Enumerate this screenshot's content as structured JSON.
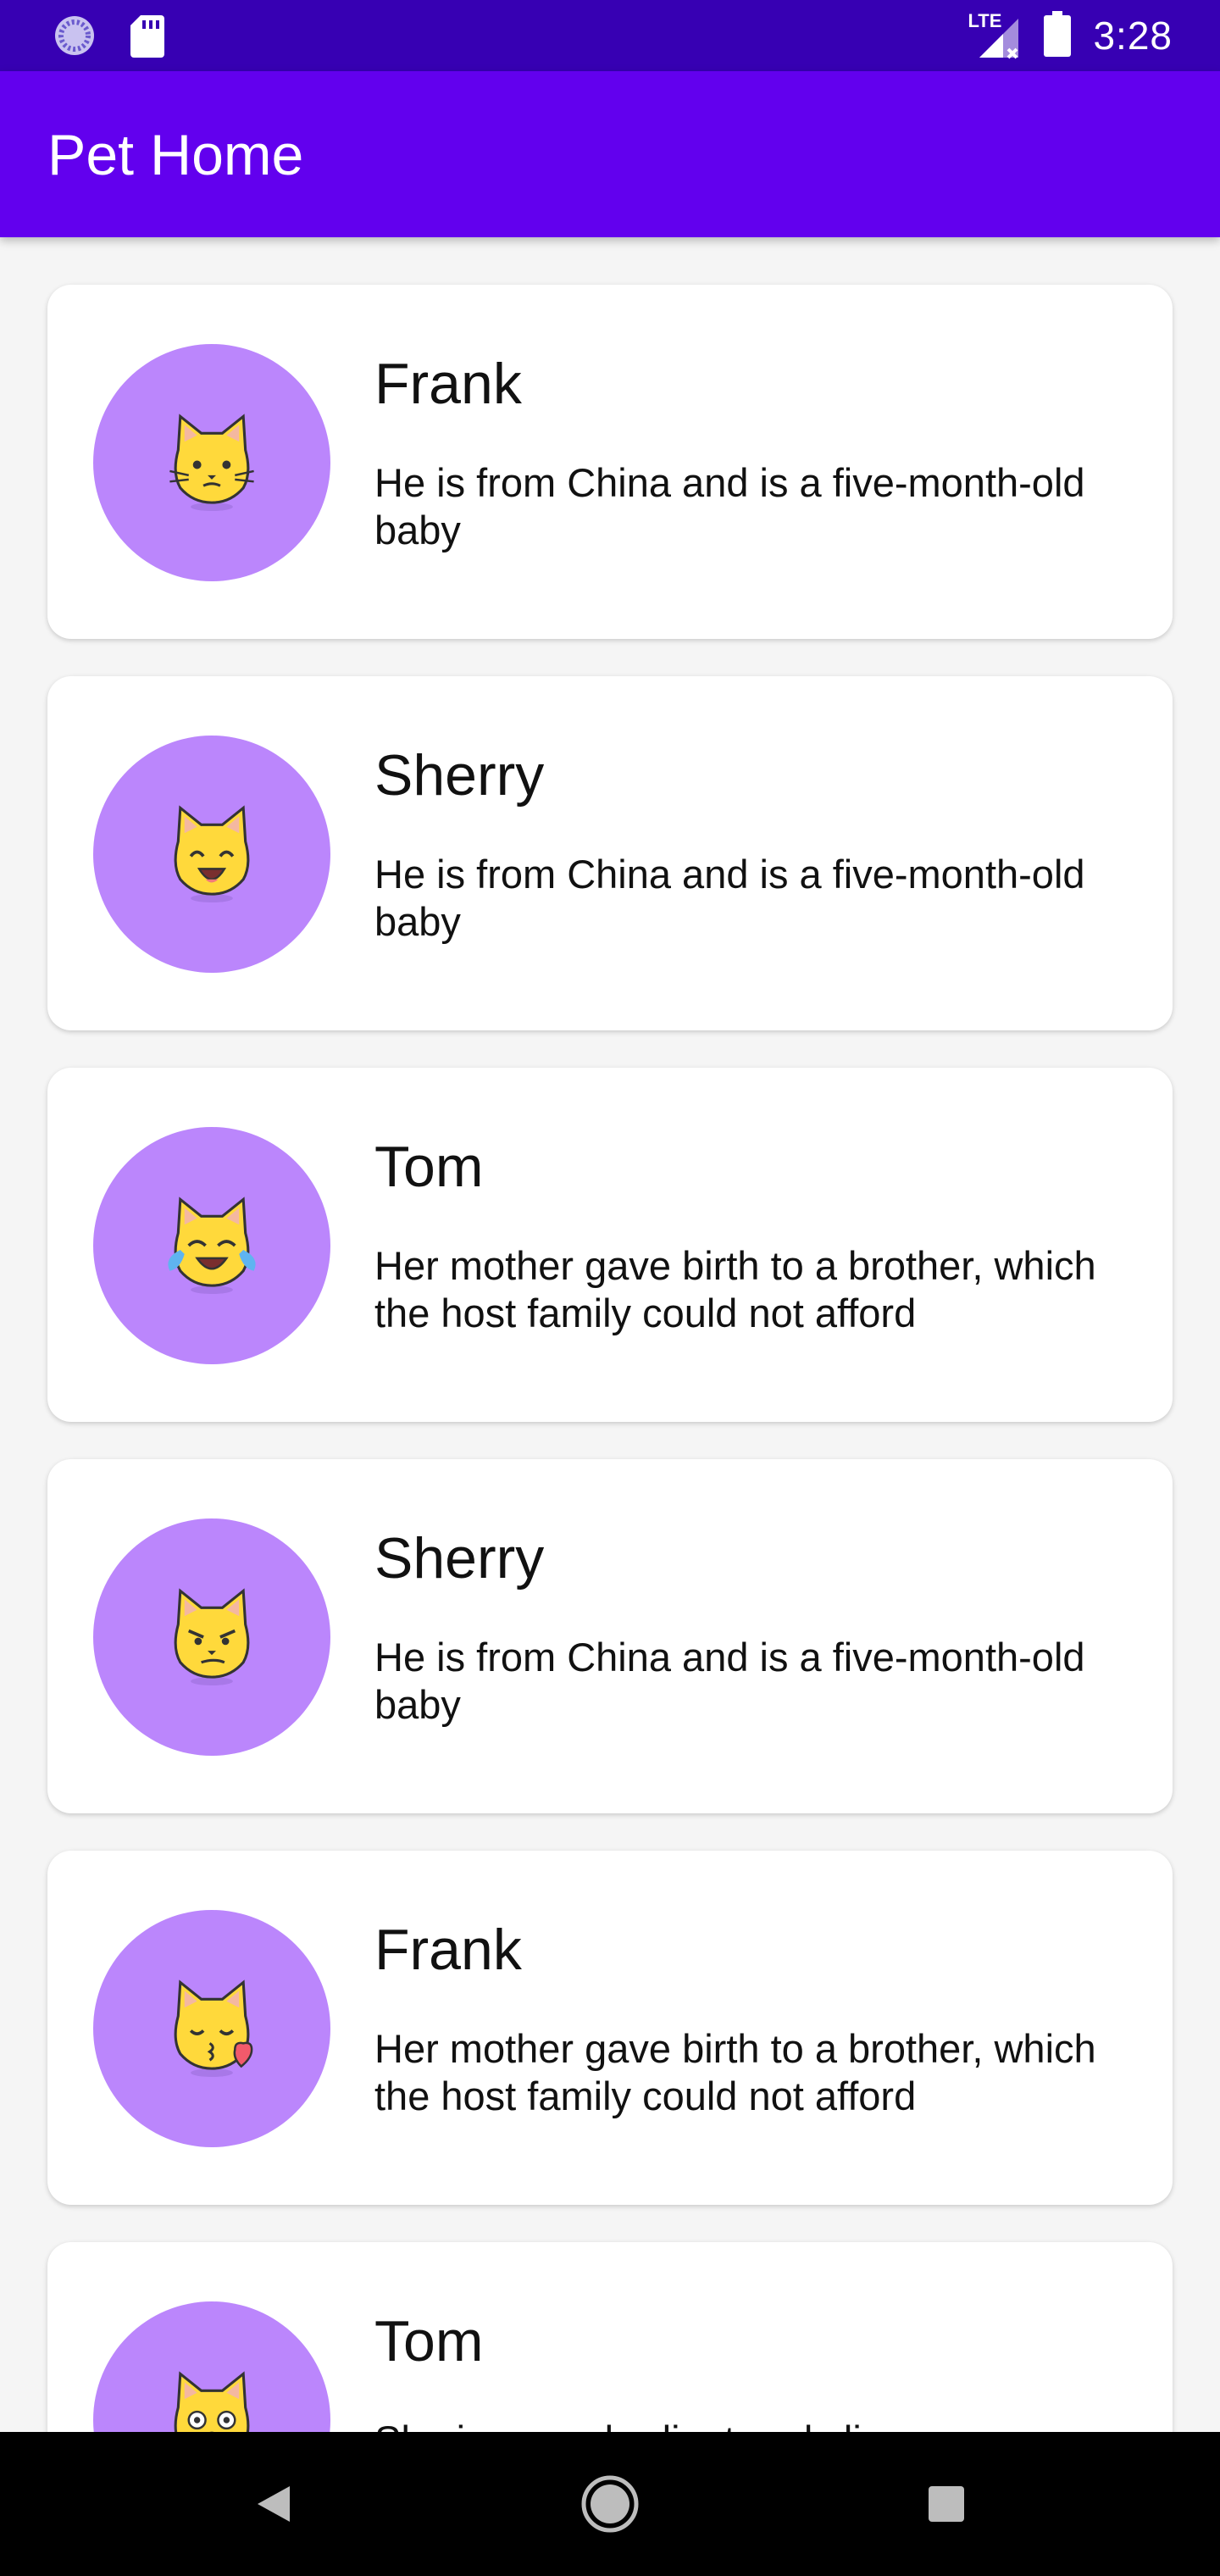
{
  "status_bar": {
    "time": "3:28",
    "network": "LTE",
    "icons": [
      "sync-icon",
      "sd-card-icon",
      "signal-icon",
      "battery-icon"
    ]
  },
  "app_bar": {
    "title": "Pet Home"
  },
  "colors": {
    "status_bar": "#3700b3",
    "app_bar": "#6200ee",
    "avatar_bg": "#bb86fc",
    "background": "#f5f5f5",
    "card": "#ffffff"
  },
  "pets": [
    {
      "name": "Frank",
      "description": "He is from China and is a five-month-old baby",
      "emoji": "cat-neutral"
    },
    {
      "name": "Sherry",
      "description": "He is from China and is a five-month-old baby",
      "emoji": "cat-happy"
    },
    {
      "name": "Tom",
      "description": "Her mother gave birth to a brother, which the host family could not afford",
      "emoji": "cat-tears-of-joy"
    },
    {
      "name": "Sherry",
      "description": "He is from China and is a five-month-old baby",
      "emoji": "cat-smirk"
    },
    {
      "name": "Frank",
      "description": "Her mother gave birth to a brother, which the host family could not afford",
      "emoji": "cat-kiss"
    },
    {
      "name": "Tom",
      "description": "She is very obedient and clingy",
      "emoji": "cat-weary"
    }
  ],
  "nav_bar": {
    "buttons": [
      "back",
      "home",
      "recents"
    ]
  }
}
